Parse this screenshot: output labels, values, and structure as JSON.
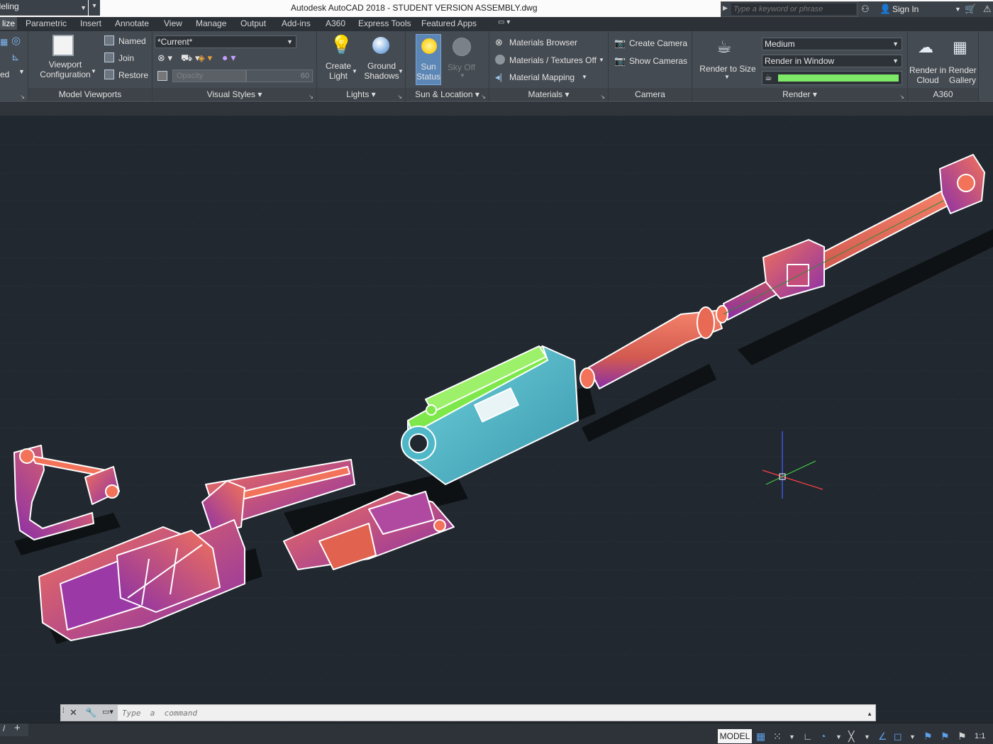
{
  "titlebar": {
    "workspace": "Modeling",
    "title": "Autodesk AutoCAD 2018 - STUDENT VERSION    ASSEMBLY.dwg",
    "search_placeholder": "Type a keyword or phrase",
    "sign_in": "Sign In"
  },
  "tabs": [
    {
      "label": "lize",
      "active": true
    },
    {
      "label": "Parametric"
    },
    {
      "label": "Insert"
    },
    {
      "label": "Annotate"
    },
    {
      "label": "View"
    },
    {
      "label": "Manage"
    },
    {
      "label": "Output"
    },
    {
      "label": "Add-ins"
    },
    {
      "label": "A360"
    },
    {
      "label": "Express Tools"
    },
    {
      "label": "Featured Apps"
    }
  ],
  "ribbon": {
    "model_viewports": {
      "title": "Model Viewports",
      "viewport_config": "Viewport\nConfiguration",
      "named": "Named",
      "join": "Join",
      "restore": "Restore",
      "left_cut_text": "ed"
    },
    "visual_styles": {
      "title": "Visual Styles",
      "current": "*Current*",
      "opacity_placeholder": "Opacity",
      "opacity_value": "60"
    },
    "lights": {
      "title": "Lights",
      "create_light": "Create\nLight",
      "ground_shadows": "Ground\nShadows"
    },
    "sun_location": {
      "title": "Sun & Location",
      "sun_status": "Sun\nStatus",
      "sky_off": "Sky Off"
    },
    "materials": {
      "title": "Materials",
      "browser": "Materials Browser",
      "textures": "Materials / Textures Off",
      "mapping": "Material Mapping"
    },
    "camera": {
      "title": "Camera",
      "create": "Create Camera",
      "show": "Show  Cameras"
    },
    "render": {
      "title": "Render",
      "render_to_size": "Render to Size",
      "quality": "Medium",
      "target": "Render in Window",
      "progress_fraction": 1.0
    },
    "a360": {
      "title": "A360",
      "render_cloud": "Render in\nCloud",
      "render_gallery": "Render\nGallery"
    }
  },
  "command_line": {
    "placeholder": "Type  a  command"
  },
  "statusbar": {
    "model": "MODEL",
    "scale": "1:1"
  },
  "colors": {
    "viewport_bg": "#212830",
    "ribbon_bg": "#454b52",
    "part_orange": "#e8654f",
    "part_purple": "#8a2fa8",
    "part_cyan": "#4fb8c8",
    "part_green": "#7ee84a",
    "sun_active": "#5b86b5"
  }
}
